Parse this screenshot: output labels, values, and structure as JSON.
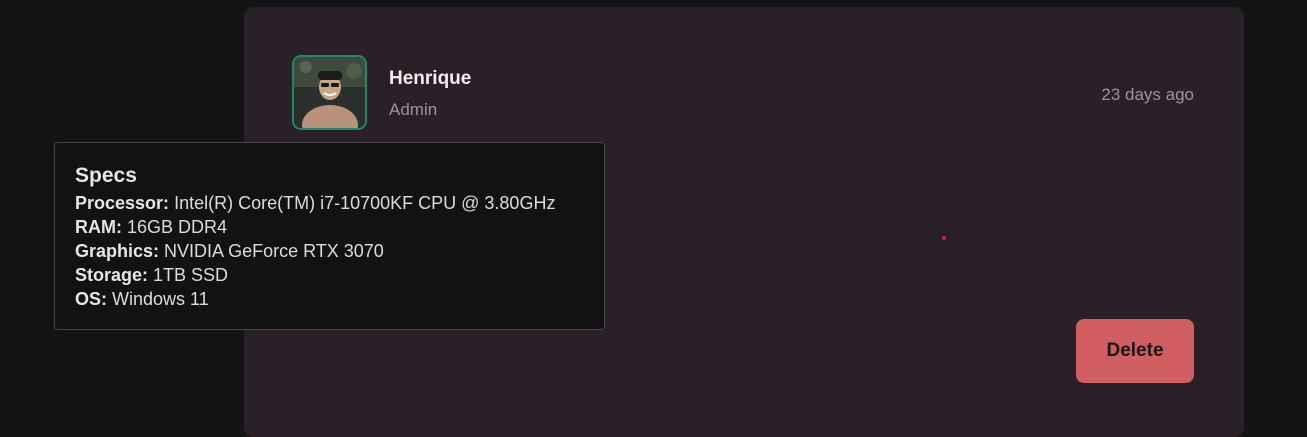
{
  "post": {
    "user_name": "Henrique",
    "user_role": "Admin",
    "timestamp": "23 days ago",
    "delete_label": "Delete"
  },
  "specs_tooltip": {
    "title": "Specs",
    "rows": [
      {
        "key": "Processor:",
        "value": "Intel(R) Core(TM) i7-10700KF CPU @ 3.80GHz"
      },
      {
        "key": "RAM:",
        "value": "16GB DDR4"
      },
      {
        "key": "Graphics:",
        "value": "NVIDIA GeForce RTX 3070"
      },
      {
        "key": "Storage:",
        "value": "1TB SSD"
      },
      {
        "key": "OS:",
        "value": "Windows 11"
      }
    ]
  },
  "colors": {
    "card_background": "#2a2027",
    "avatar_border": "#1f8a63",
    "delete_button": "#d15e60",
    "tooltip_background": "#121114"
  }
}
